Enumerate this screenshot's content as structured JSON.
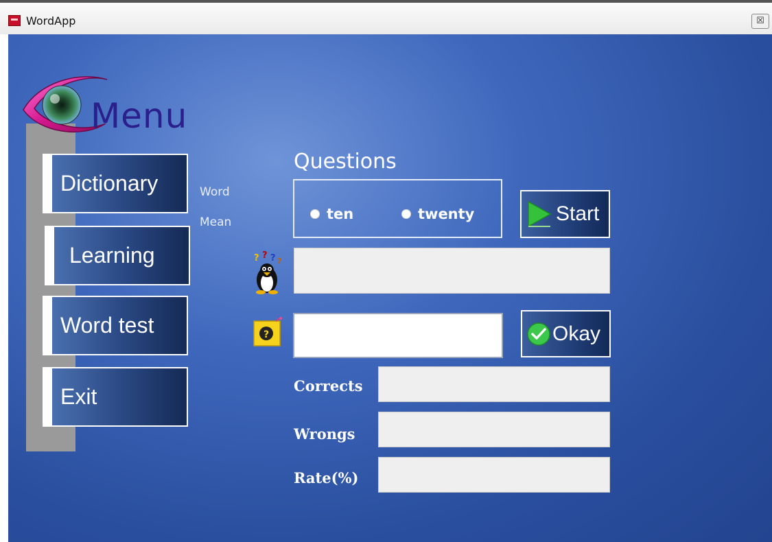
{
  "window": {
    "title": "WordApp",
    "close_glyph": "☒"
  },
  "menu": {
    "title": "Menu",
    "items": [
      {
        "label": "Dictionary"
      },
      {
        "label": "Learning"
      },
      {
        "label": "Word test"
      },
      {
        "label": "Exit"
      }
    ]
  },
  "side_labels": {
    "word": "Word",
    "mean": "Mean"
  },
  "questions": {
    "label": "Questions",
    "options": [
      {
        "label": "ten"
      },
      {
        "label": "twenty"
      }
    ],
    "start_label": "Start"
  },
  "answer": {
    "okay_label": "Okay"
  },
  "stats": {
    "corrects_label": "Corrects",
    "wrongs_label": "Wrongs",
    "rate_label": "Rate(%)"
  },
  "icons": {
    "app": "app-icon",
    "logo": "eye-logo-icon",
    "question": "penguin-question-icon",
    "answer": "question-note-icon",
    "start": "play-icon",
    "okay": "check-icon"
  },
  "colors": {
    "background": "#3f68bd",
    "menu_title": "#2a1f8c",
    "button_gradient_start": "#4a6fae",
    "button_gradient_end": "#152a55",
    "start_icon": "#35c23a",
    "okay_icon": "#3cc84a"
  }
}
